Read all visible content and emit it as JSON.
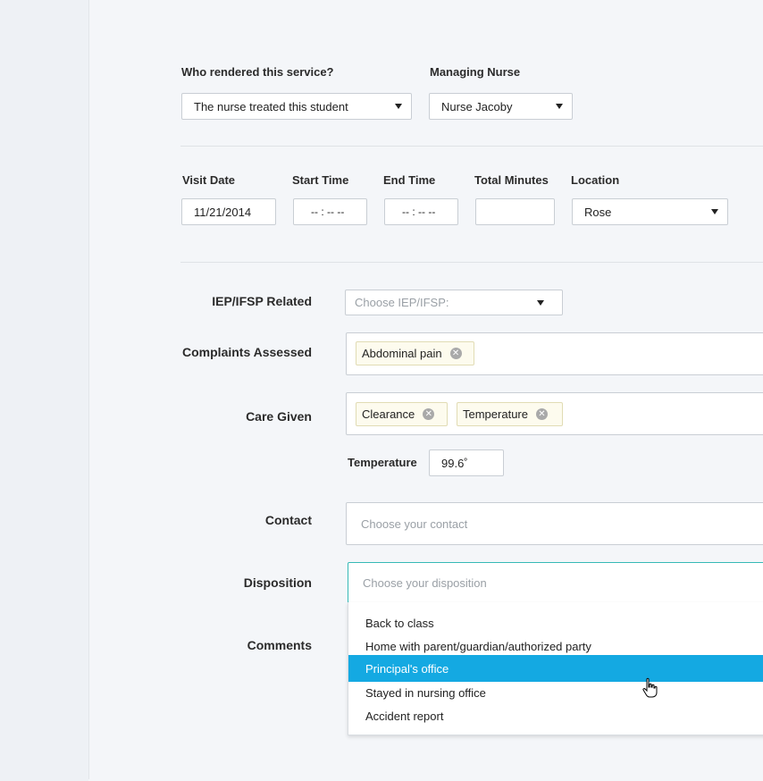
{
  "service": {
    "rendered_label": "Who rendered this service?",
    "rendered_value": "The nurse treated this student",
    "nurse_label": "Managing Nurse",
    "nurse_value": "Nurse Jacoby"
  },
  "visit": {
    "date_label": "Visit Date",
    "date_value": "11/21/2014",
    "start_label": "Start Time",
    "start_value": "-- : -- --",
    "end_label": "End Time",
    "end_value": "-- : -- --",
    "total_label": "Total Minutes",
    "total_value": "",
    "location_label": "Location",
    "location_value": "Rose"
  },
  "iep": {
    "label": "IEP/IFSP Related",
    "placeholder": "Choose IEP/IFSP:"
  },
  "complaints": {
    "label": "Complaints Assessed",
    "tags": [
      "Abdominal pain"
    ]
  },
  "care": {
    "label": "Care Given",
    "tags": [
      "Clearance",
      "Temperature"
    ],
    "temperature_label": "Temperature",
    "temperature_value": "99.6˚"
  },
  "contact": {
    "label": "Contact",
    "placeholder": "Choose your contact"
  },
  "disposition": {
    "label": "Disposition",
    "placeholder": "Choose your disposition",
    "options": [
      "Back to class",
      "Home with parent/guardian/authorized party",
      "Principal's office",
      "Stayed in nursing office",
      "Accident report"
    ],
    "highlighted": "Principal's office"
  },
  "comments": {
    "label": "Comments"
  },
  "colors": {
    "highlight": "#14a9e2",
    "tag_bg": "#fdfbee",
    "focus_border": "#36b9b6"
  }
}
